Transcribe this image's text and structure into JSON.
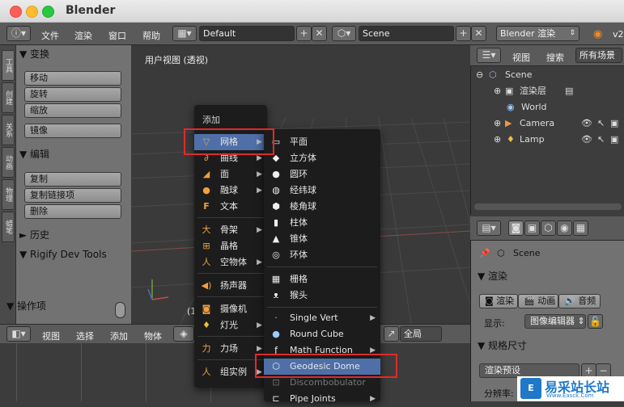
{
  "window": {
    "title": "Blender"
  },
  "info_header": {
    "menus": [
      "文件",
      "渲染",
      "窗口",
      "帮助"
    ],
    "layout": "Default",
    "scene": "Scene",
    "engine": "Blender 渲染",
    "version": "v2"
  },
  "tool_tabs": [
    "工具",
    "创建",
    "关系",
    "动画",
    "物理",
    "蜡笔"
  ],
  "tool_shelf": {
    "transform_header": "变换",
    "transform_buttons": [
      "移动",
      "旋转",
      "缩放"
    ],
    "mirror_button": "镜像",
    "edit_header": "编辑",
    "edit_buttons": [
      "复制",
      "复制链接项",
      "删除"
    ],
    "history_header": "历史",
    "rigify_header": "Rigify Dev Tools",
    "operator_header": "操作项"
  },
  "viewport": {
    "label": "用户视图 (透视)",
    "frame_hint": "(1"
  },
  "view_header": {
    "menus": [
      "视图",
      "选择",
      "添加",
      "物体"
    ],
    "pivot": "全局"
  },
  "add_menu": {
    "title": "添加",
    "items": [
      {
        "label": "网格",
        "icon": "mesh-icon"
      },
      {
        "label": "曲线",
        "icon": "curve-icon"
      },
      {
        "label": "面",
        "icon": "surface-icon"
      },
      {
        "label": "融球",
        "icon": "metaball-icon"
      },
      {
        "label": "文本",
        "icon": "text-icon"
      },
      {
        "label": "骨架",
        "icon": "armature-icon"
      },
      {
        "label": "晶格",
        "icon": "lattice-icon"
      },
      {
        "label": "空物体",
        "icon": "empty-icon"
      },
      {
        "label": "扬声器",
        "icon": "speaker-icon"
      },
      {
        "label": "摄像机",
        "icon": "camera-icon"
      },
      {
        "label": "灯光",
        "icon": "lamp-icon"
      },
      {
        "label": "力场",
        "icon": "forcefield-icon"
      },
      {
        "label": "组实例",
        "icon": "group-instance-icon"
      }
    ]
  },
  "mesh_submenu": {
    "items": [
      {
        "label": "平面",
        "icon": "plane-icon"
      },
      {
        "label": "立方体",
        "icon": "cube-icon"
      },
      {
        "label": "圆环",
        "icon": "circle-icon"
      },
      {
        "label": "经纬球",
        "icon": "uvsphere-icon"
      },
      {
        "label": "棱角球",
        "icon": "icosphere-icon"
      },
      {
        "label": "柱体",
        "icon": "cylinder-icon"
      },
      {
        "label": "锥体",
        "icon": "cone-icon"
      },
      {
        "label": "环体",
        "icon": "torus-icon"
      },
      {
        "label": "栅格",
        "icon": "grid-icon"
      },
      {
        "label": "猴头",
        "icon": "monkey-icon"
      },
      {
        "label": "Single Vert",
        "icon": "vertex-icon"
      },
      {
        "label": "Round Cube",
        "icon": "roundcube-icon"
      },
      {
        "label": "Math Function",
        "icon": "function-icon"
      },
      {
        "label": "Geodesic Dome",
        "icon": "dome-icon"
      },
      {
        "label": "Discombobulator",
        "icon": "discombobulator-icon"
      },
      {
        "label": "Pipe Joints",
        "icon": "pipe-icon"
      }
    ]
  },
  "outliner": {
    "header_items": [
      "视图",
      "搜索",
      "所有场景"
    ],
    "rows": [
      {
        "label": "Scene"
      },
      {
        "label": "渲染层"
      },
      {
        "label": "World"
      },
      {
        "label": "Camera"
      },
      {
        "label": "Lamp"
      }
    ]
  },
  "properties": {
    "scene_path": "Scene",
    "render_header": "渲染",
    "render_buttons": [
      "渲染",
      "动画",
      "音频"
    ],
    "display_label": "显示:",
    "display_value": "图像编辑器",
    "dimensions_header": "规格尺寸",
    "preset_label": "渲染预设",
    "resolution_label": "分辨率:"
  },
  "watermark": {
    "text": "易采站长站",
    "subtext": "Www.Easck.Com"
  },
  "colors": {
    "highlight": "#4f6fa8",
    "annotation": "#e02a2a"
  }
}
